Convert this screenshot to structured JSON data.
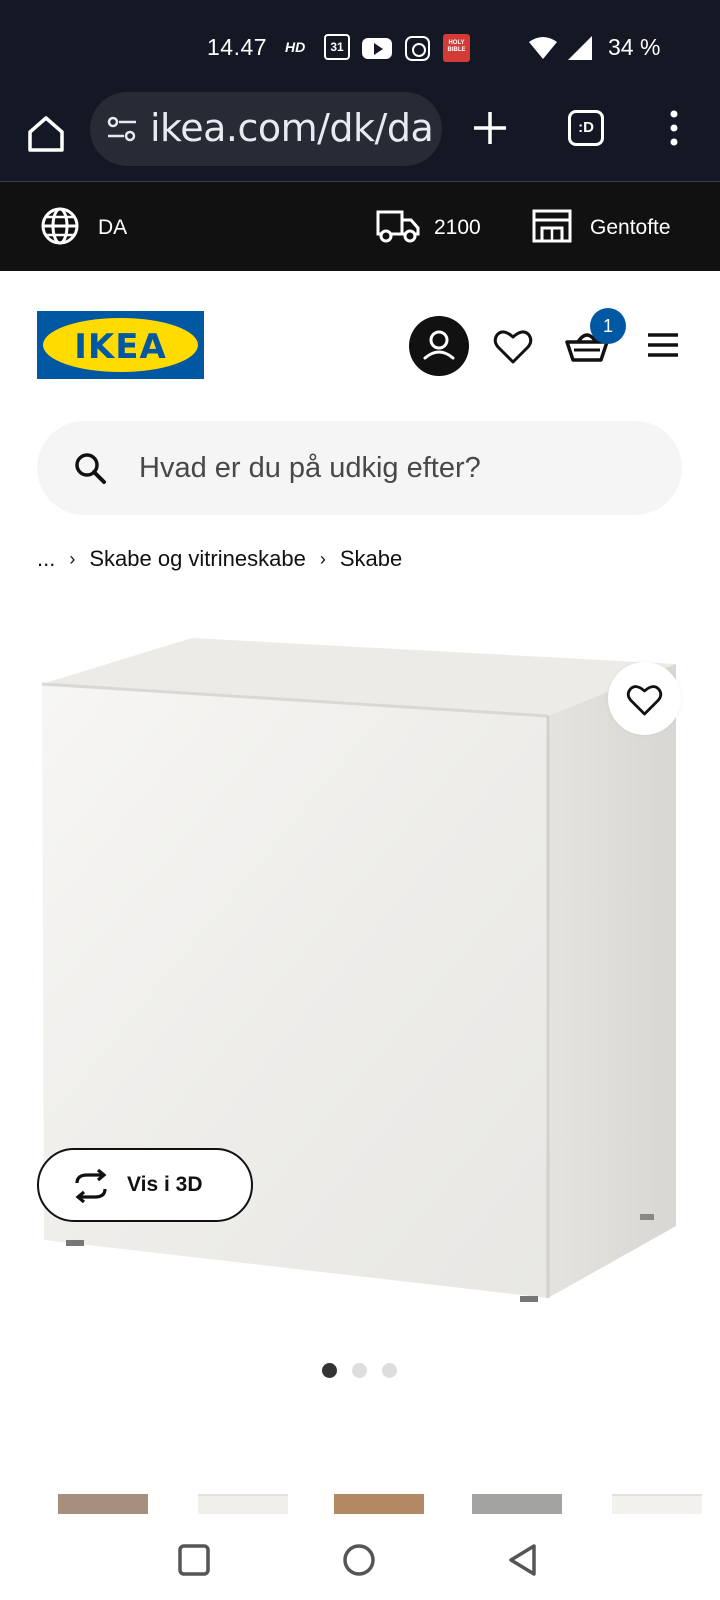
{
  "status_bar": {
    "time": "14.47",
    "hd": "HD",
    "calendar_day": "31",
    "bible_label": "HOLY BIBLE",
    "battery": "34 %"
  },
  "browser": {
    "url": "ikea.com/dk/da",
    "tabs_label": ":D"
  },
  "top_strip": {
    "language": "DA",
    "delivery_postcode": "2100",
    "store": "Gentofte"
  },
  "header": {
    "logo_text": "IKEA",
    "cart_count": "1"
  },
  "search": {
    "placeholder": "Hvad er du på udkig efter?"
  },
  "breadcrumb": {
    "items": [
      "...",
      "Skabe og vitrineskabe",
      "Skabe"
    ]
  },
  "product": {
    "view_3d_label": "Vis i 3D",
    "image_count": 3,
    "active_image": 1
  },
  "colors": {
    "ikea_blue": "#0058a3",
    "ikea_yellow": "#ffdb00",
    "status_bar_bg": "#141824"
  }
}
